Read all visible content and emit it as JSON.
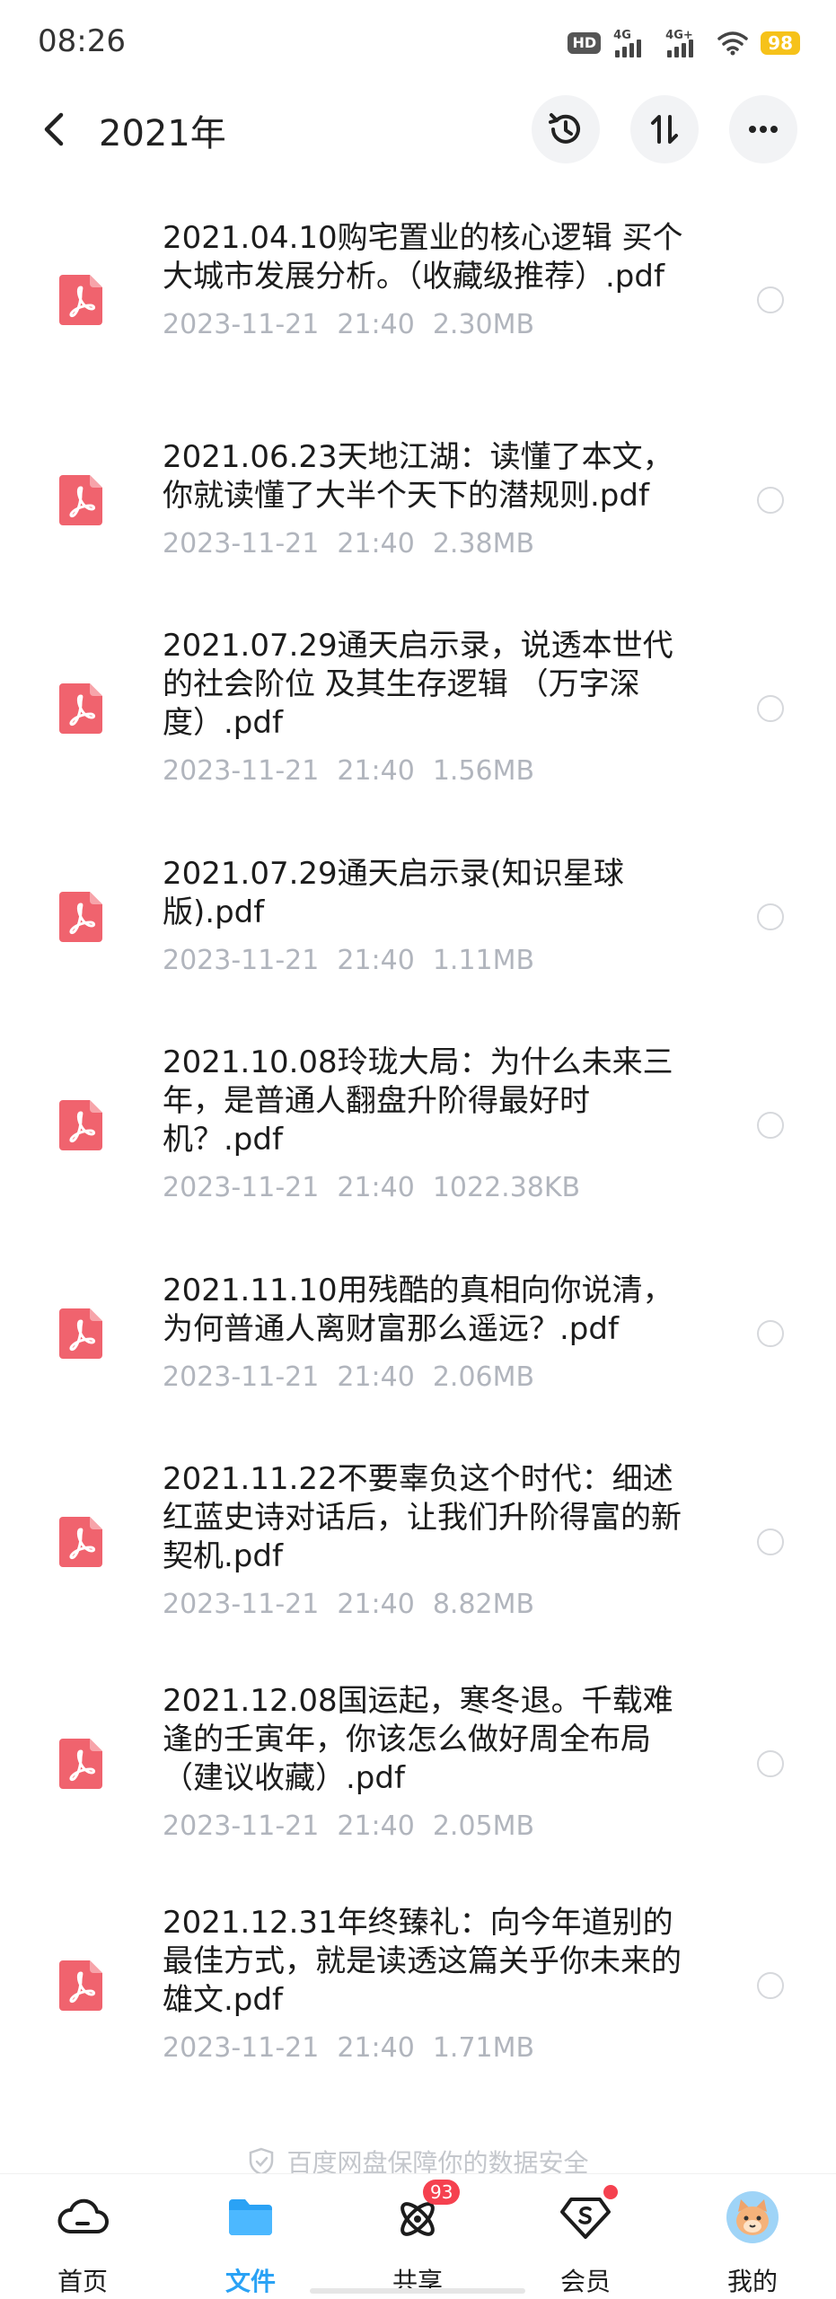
{
  "status": {
    "time": "08:26",
    "hd": "HD",
    "net1": "4G",
    "net2": "4G+",
    "battery": "98"
  },
  "header": {
    "title": "2021年"
  },
  "files": [
    {
      "name": "2021.04.10购宅置业的核心逻辑 买个大城市发展分析。（收藏级推荐）.pdf",
      "date": "2023-11-21",
      "time": "21:40",
      "size": "2.30MB"
    },
    {
      "name": "2021.06.23天地江湖：读懂了本文，你就读懂了大半个天下的潜规则.pdf",
      "date": "2023-11-21",
      "time": "21:40",
      "size": "2.38MB"
    },
    {
      "name": "2021.07.29通天启示录，说透本世代的社会阶位 及其生存逻辑 （万字深度）.pdf",
      "date": "2023-11-21",
      "time": "21:40",
      "size": "1.56MB"
    },
    {
      "name": "2021.07.29通天启示录(知识星球版).pdf",
      "date": "2023-11-21",
      "time": "21:40",
      "size": "1.11MB"
    },
    {
      "name": "2021.10.08玲珑大局：为什么未来三年，是普通人翻盘升阶得最好时机？.pdf",
      "date": "2023-11-21",
      "time": "21:40",
      "size": "1022.38KB"
    },
    {
      "name": "2021.11.10用残酷的真相向你说清，为何普通人离财富那么遥远？.pdf",
      "date": "2023-11-21",
      "time": "21:40",
      "size": "2.06MB"
    },
    {
      "name": "2021.11.22不要辜负这个时代：细述红蓝史诗对话后，让我们升阶得富的新契机.pdf",
      "date": "2023-11-21",
      "time": "21:40",
      "size": "8.82MB"
    },
    {
      "name": "2021.12.08国运起，寒冬退。千载难逢的壬寅年，你该怎么做好周全布局（建议收藏）.pdf",
      "date": "2023-11-21",
      "time": "21:40",
      "size": "2.05MB"
    },
    {
      "name": "2021.12.31年终臻礼：向今年道别的最佳方式，就是读透这篇关乎你未来的雄文.pdf",
      "date": "2023-11-21",
      "time": "21:40",
      "size": "1.71MB"
    }
  ],
  "footer": {
    "note": "百度网盘保障你的数据安全"
  },
  "tabs": {
    "home": "首页",
    "files": "文件",
    "share": "共享",
    "share_badge": "93",
    "vip": "会员",
    "mine": "我的"
  },
  "colors": {
    "accent": "#2aa2f5",
    "pdf_red": "#f0636e",
    "badge_red": "#f5414f",
    "meta_gray": "#b1b5bd"
  }
}
